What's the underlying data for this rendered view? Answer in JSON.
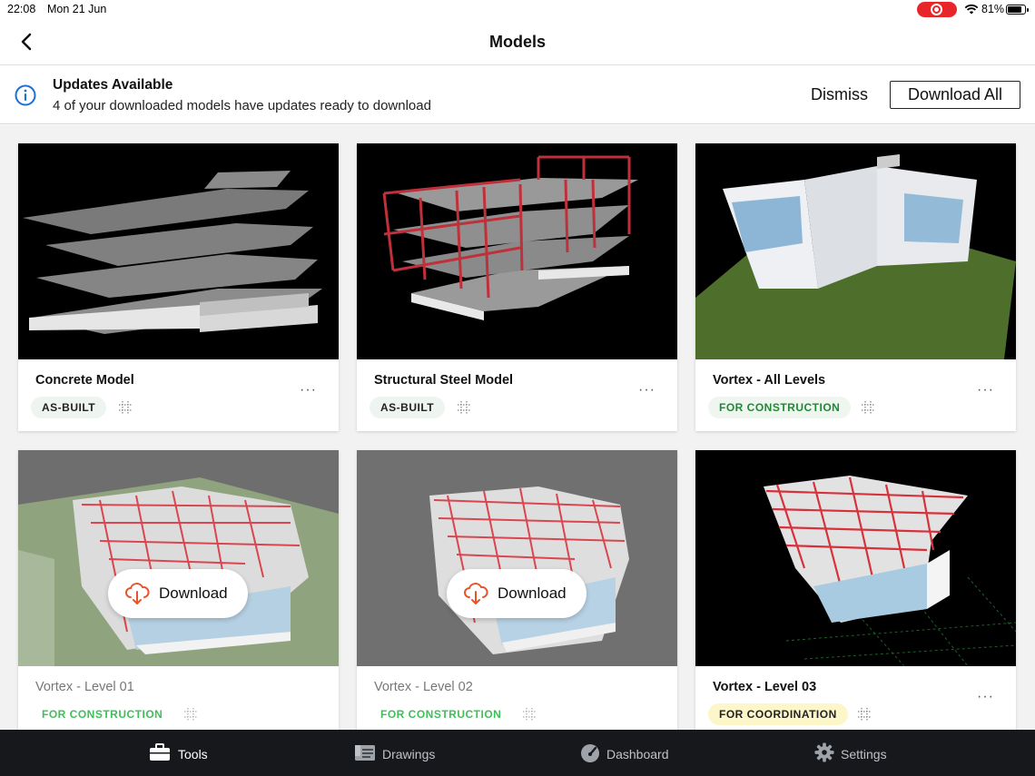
{
  "status_bar": {
    "time": "22:08",
    "date": "Mon 21 Jun",
    "battery": "81%",
    "battery_level": 0.81
  },
  "nav": {
    "title": "Models",
    "back_icon": "chevron-left-icon"
  },
  "banner": {
    "title": "Updates Available",
    "subtitle": "4 of your downloaded models have updates ready to download",
    "dismiss_label": "Dismiss",
    "download_all_label": "Download All",
    "icon": "info-icon",
    "icon_color": "#1a6fd8"
  },
  "models": [
    {
      "name": "Concrete Model",
      "status": "AS-BUILT",
      "downloaded": true
    },
    {
      "name": "Structural Steel Model",
      "status": "AS-BUILT",
      "downloaded": true
    },
    {
      "name": "Vortex - All Levels",
      "status": "FOR CONSTRUCTION",
      "downloaded": true
    },
    {
      "name": "Vortex - Level 01",
      "status": "FOR CONSTRUCTION",
      "downloaded": false,
      "download_label": "Download"
    },
    {
      "name": "Vortex - Level 02",
      "status": "FOR CONSTRUCTION",
      "downloaded": false,
      "download_label": "Download"
    },
    {
      "name": "Vortex - Level 03",
      "status": "FOR COORDINATION",
      "downloaded": true
    }
  ],
  "more_label": "···",
  "tabs": [
    {
      "label": "Tools",
      "icon": "toolbox-icon",
      "active": true
    },
    {
      "label": "Drawings",
      "icon": "drawings-icon",
      "active": false
    },
    {
      "label": "Dashboard",
      "icon": "dashboard-gauge-icon",
      "active": false
    },
    {
      "label": "Settings",
      "icon": "gear-icon",
      "active": false
    }
  ],
  "colors": {
    "accent_download": "#e8542a",
    "construction_green": "#1f8a34",
    "coordination_yellow": "#fdf6c9",
    "tab_bar_bg": "#16181c"
  }
}
